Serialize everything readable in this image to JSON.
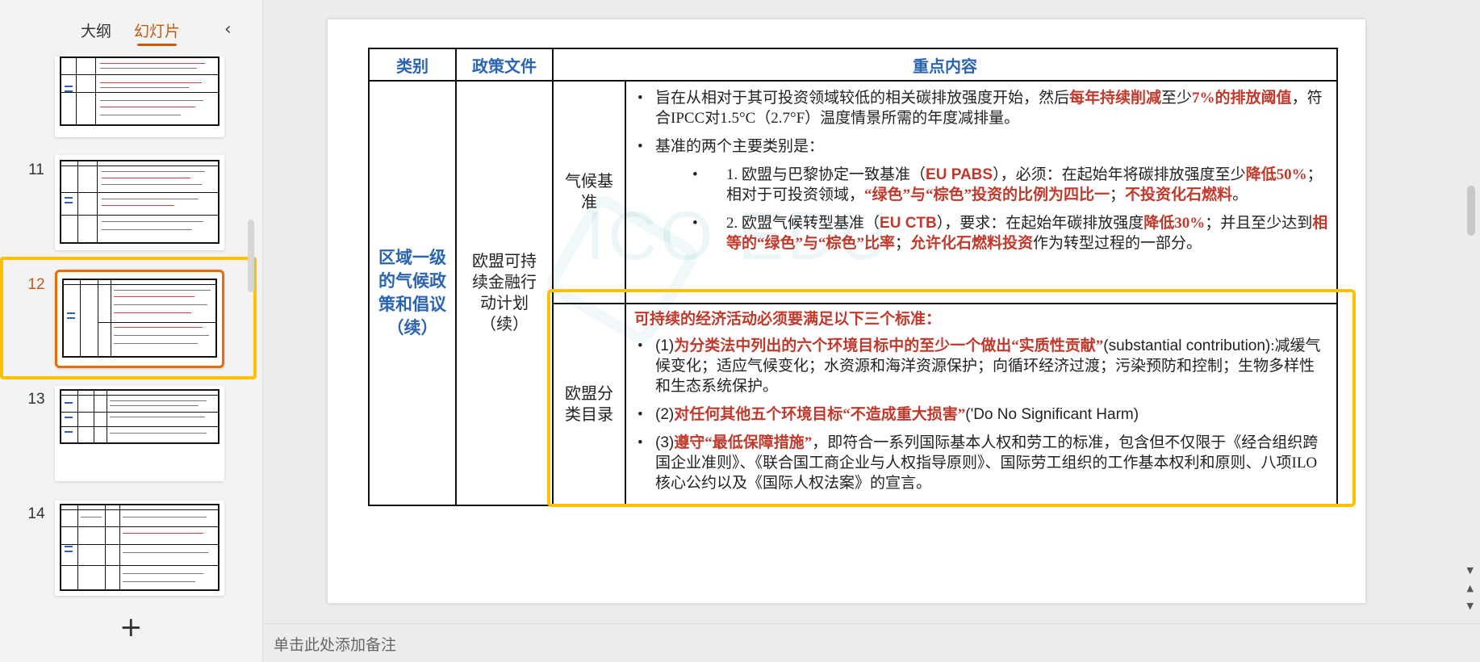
{
  "sidebar": {
    "tab_outline": "大纲",
    "tab_slides": "幻灯片",
    "collapse_icon": "‹",
    "slide_numbers": [
      "11",
      "12",
      "13",
      "14"
    ],
    "selected_slide": "12",
    "add_icon": "+"
  },
  "slide": {
    "headers": [
      "类别",
      "政策文件",
      "重点内容"
    ],
    "category": "区域一级的气候政策和倡议（续）",
    "policy_doc": "欧盟可持续金融行动计划（续）",
    "row1": {
      "sub": "气候基准",
      "b1_pre": "旨在从相对于其可投资领域较低的相关碳排放强度开始，然后",
      "b1_red1": "每年持续削减",
      "b1_mid": "至少",
      "b1_red2": "7%的排放阈值",
      "b1_post": "，符合IPCC对1.5°C（2.7°F）温度情景所需的年度减排量。",
      "b2": "基准的两个主要类别是：",
      "s1_pre": "1. 欧盟与巴黎协定一致基准（",
      "s1_red1": "EU PABS",
      "s1_mid1": "），必须：在起始年将碳排放强度至少",
      "s1_red2": "降低50%",
      "s1_mid2": "；相对于可投资领域，",
      "s1_red3": "“绿色”与“棕色”投资的比例为四比一",
      "s1_mid3": "；",
      "s1_red4": "不投资化石燃料",
      "s1_post": "。",
      "s2_pre": "2. 欧盟气候转型基准（",
      "s2_red1": "EU CTB",
      "s2_mid1": "），要求：在起始年碳排放强度",
      "s2_red2": "降低30%",
      "s2_mid2": "；并且至少达到",
      "s2_red3": "相等的“绿色”与“棕色”比率",
      "s2_mid3": "；",
      "s2_red4": "允许化石燃料投资",
      "s2_post": "作为转型过程的一部分。"
    },
    "row2": {
      "sub": "欧盟分类目录",
      "heading": "可持续的经济活动必须要满足以下三个标准：",
      "c1_num": "(1)",
      "c1_red": "为分类法中列出的六个环境目标中的至少一个做出“实质性贡献”",
      "c1_en": "(substantial contribution)",
      "c1_post": ":减缓气候变化；适应气候变化；水资源和海洋资源保护；向循环经济过渡；污染预防和控制；生物多样性和生态系统保护。",
      "c2_num": "(2)",
      "c2_red": "对任何其他五个环境目标“不造成重大损害”",
      "c2_en": "('Do No Significant Harm)",
      "c3_num": "(3)",
      "c3_red": "遵守“最低保障措施”",
      "c3_post": "，即符合一系列国际基本人权和劳工的标准，包含但不仅限于《经合组织跨国企业准则》、《联合国工商企业与人权指导原则》、国际劳工组织的工作基本权利和原则、八项ILO核心公约以及《国际人权法案》的宣言。"
    }
  },
  "notes": {
    "placeholder": "单击此处添加备注"
  },
  "colors": {
    "accent": "#c55a11",
    "highlight": "#ffc000",
    "header_blue": "#2b64b0",
    "emphasis_red": "#c0392b"
  }
}
